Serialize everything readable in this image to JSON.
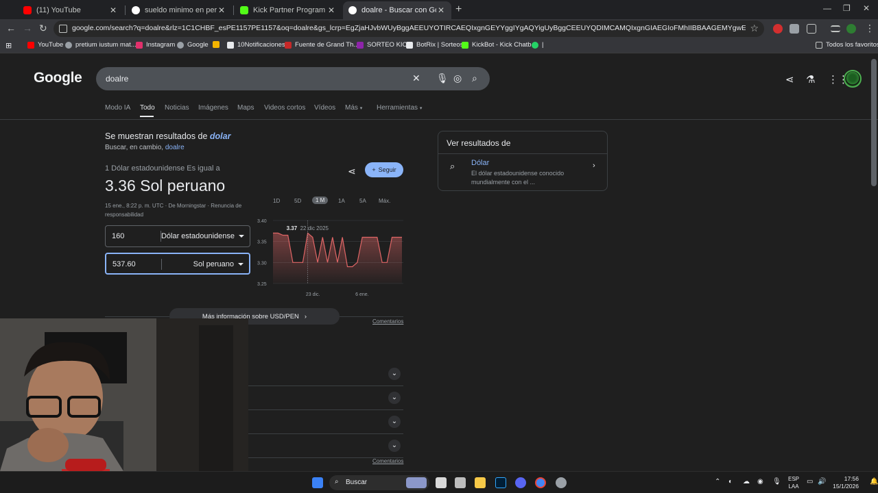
{
  "browser": {
    "tabs": [
      {
        "title": "(11) YouTube",
        "color": "#ff0000"
      },
      {
        "title": "sueldo minimo en peru - Busca",
        "color": "#ffffff"
      },
      {
        "title": "Kick Partner Program - Kick Da",
        "color": "#53fc18"
      },
      {
        "title": "doalre - Buscar con Google",
        "color": "#ffffff"
      }
    ],
    "url": "google.com/search?q=doalre&rlz=1C1CHBF_esPE1157PE1157&oq=doalre&gs_lcrp=EgZjaHJvbWUyBggAEEUYOTIRCAEQIxgnGEYYggIYgAQYigUyBggCEEUYQDIMCAMQIxgnGIAEGIoFMhIIBBAAGEMYgwEYsQMYgAQYigUyDwgFEAAYQxixAxi...",
    "bookmarks": [
      {
        "label": "YouTube",
        "color": "#ff0000"
      },
      {
        "label": "pretium iustum mat...",
        "color": "#9aa0a6"
      },
      {
        "label": "Instagram",
        "color": "#e1306c"
      },
      {
        "label": "Google",
        "color": "#9aa0a6"
      },
      {
        "label": "",
        "color": "#f4b400"
      },
      {
        "label": "10Notificaciones",
        "color": "#e8eaed"
      },
      {
        "label": "Fuente de Grand Th...",
        "color": "#c62828"
      },
      {
        "label": "SORTEO KICK",
        "color": "#8e24aa"
      },
      {
        "label": "BotRix | Sorteos",
        "color": "#e8eaed"
      },
      {
        "label": "KickBot - Kick Chatb...",
        "color": "#53fc18"
      },
      {
        "label": "|",
        "color": "#25d366"
      }
    ],
    "all_bookmarks": "Todos los favoritos"
  },
  "google": {
    "logo": "Google",
    "query": "doalre",
    "nav": [
      "Modo IA",
      "Todo",
      "Noticias",
      "Imágenes",
      "Maps",
      "Videos cortos",
      "Vídeos",
      "Más",
      "Herramientas"
    ],
    "showing_prefix": "Se muestran resultados de",
    "showing_term": "dolar",
    "instead_prefix": "Buscar, en cambio,",
    "instead_term": "doalre"
  },
  "converter": {
    "equals_text": "1 Dólar estadounidense Es igual a",
    "result": "3.36 Sol peruano",
    "meta": "15 ene., 8:22 p. m. UTC · De Morningstar · Renuncia de responsabilidad",
    "follow_label": "Seguir",
    "from_value": "160",
    "from_currency": "Dólar estadounidense",
    "to_value": "537.60",
    "to_currency": "Sol peruano",
    "ranges": [
      "1D",
      "5D",
      "1 M",
      "1A",
      "5A",
      "Máx."
    ],
    "selected_range": "1 M",
    "more_info": "Más información sobre USD/PEN",
    "comments": "Comentarios"
  },
  "chart_data": {
    "type": "area",
    "x_ticks": [
      "23 dic.",
      "6 ene."
    ],
    "y_ticks": [
      "3.40",
      "3.35",
      "3.30",
      "3.25"
    ],
    "ylim": [
      3.25,
      3.4
    ],
    "values": [
      3.37,
      3.37,
      3.365,
      3.365,
      3.3,
      3.3,
      3.3,
      3.37,
      3.36,
      3.3,
      3.36,
      3.3,
      3.36,
      3.3,
      3.36,
      3.29,
      3.29,
      3.3,
      3.36,
      3.36,
      3.36,
      3.36,
      3.3,
      3.3,
      3.36,
      3.36,
      3.36
    ],
    "hover_value": "3.37",
    "hover_date": "22 dic 2025",
    "hover_index": 7,
    "line_color": "#e06666"
  },
  "knowledge": {
    "heading": "Ver resultados de",
    "item_title": "Dólar",
    "item_desc": "El dólar estadounidense conocido mundialmente con el ..."
  },
  "taskbar": {
    "search_label": "Buscar",
    "lang": "ESP",
    "lang2": "LAA",
    "time": "17:56",
    "date": "15/1/2026"
  }
}
